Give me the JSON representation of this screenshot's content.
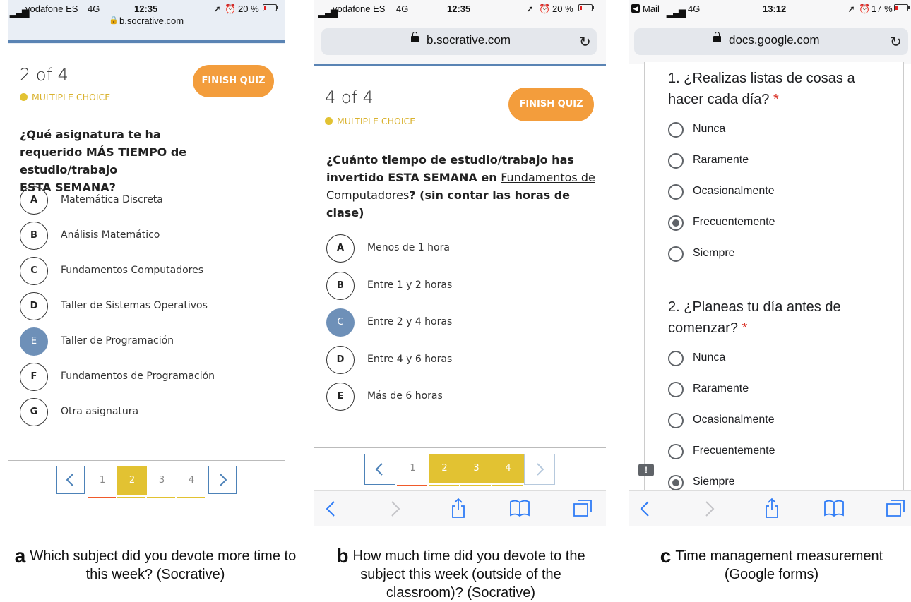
{
  "panel_a": {
    "status": {
      "carrier": "vodafone ES",
      "network": "4G",
      "time": "12:35",
      "battery": "20 %",
      "battery_level": 0.2,
      "url": "b.socrative.com"
    },
    "counter": "2 of 4",
    "question_type": "MULTIPLE CHOICE",
    "finish_label": "FINISH QUIZ",
    "question_lines": [
      "¿Qué asignatura te ha",
      "requerido MÁS TIEMPO de estudio/trabajo",
      "ESTA SEMANA?"
    ],
    "options": [
      {
        "letter": "A",
        "text": "Matemática Discreta",
        "selected": false
      },
      {
        "letter": "B",
        "text": "Análisis Matemático",
        "selected": false
      },
      {
        "letter": "C",
        "text": "Fundamentos Computadores",
        "selected": false
      },
      {
        "letter": "D",
        "text": "Taller de Sistemas Operativos",
        "selected": false
      },
      {
        "letter": "E",
        "text": "Taller de Programación",
        "selected": true
      },
      {
        "letter": "F",
        "text": "Fundamentos de Programación",
        "selected": false
      },
      {
        "letter": "G",
        "text": "Otra asignatura",
        "selected": false
      }
    ],
    "pages": [
      "1",
      "2",
      "3",
      "4"
    ],
    "current_page": "2",
    "caption_letter": "a",
    "caption": "Which subject did you devote more time to this week? (Socrative)"
  },
  "panel_b": {
    "status": {
      "carrier": "vodafone ES",
      "network": "4G",
      "time": "12:35",
      "battery": "20 %",
      "battery_level": 0.2,
      "url": "b.socrative.com"
    },
    "counter": "4 of 4",
    "question_type": "MULTIPLE CHOICE",
    "finish_label": "FINISH QUIZ",
    "question": {
      "line1": "¿Cuánto tiempo de estudio/trabajo has",
      "line2_prefix": "invertido ESTA SEMANA en ",
      "line2_link": "Fundamentos de",
      "line3_link": "Computadores",
      "line3_suffix": "? (sin contar las horas de",
      "line4": "clase)"
    },
    "options": [
      {
        "letter": "A",
        "text": "Menos de 1 hora",
        "selected": false
      },
      {
        "letter": "B",
        "text": "Entre 1 y 2 horas",
        "selected": false
      },
      {
        "letter": "C",
        "text": "Entre 2 y 4 horas",
        "selected": true
      },
      {
        "letter": "D",
        "text": "Entre 4 y 6 horas",
        "selected": false
      },
      {
        "letter": "E",
        "text": "Más de 6 horas",
        "selected": false
      }
    ],
    "pages": [
      "1",
      "2",
      "3",
      "4"
    ],
    "current_page": "4",
    "caption_letter": "b",
    "caption": "How much time did you devote to the subject this week (outside of the classroom)? (Socrative)"
  },
  "panel_c": {
    "status": {
      "back_app": "Mail",
      "network": "4G",
      "time": "13:12",
      "battery": "17 %",
      "battery_level": 0.17,
      "url": "docs.google.com"
    },
    "questions": [
      {
        "line1": "1. ¿Realizas listas de cosas a",
        "line2": "hacer cada día?",
        "required": "*",
        "options": [
          "Nunca",
          "Raramente",
          "Ocasionalmente",
          "Frecuentemente",
          "Siempre"
        ],
        "selected": 3
      },
      {
        "line1": "2. ¿Planeas tu día antes de",
        "line2": "comenzar?",
        "required": "*",
        "options": [
          "Nunca",
          "Raramente",
          "Ocasionalmente",
          "Frecuentemente",
          "Siempre"
        ],
        "selected": 4
      }
    ],
    "caption_letter": "c",
    "caption": "Time management measurement (Google forms)"
  },
  "colors": {
    "finish": "#f39d3c",
    "accent_yellow": "#e2c232",
    "selected_blue": "#6e90b8",
    "nav_blue": "#4d82b8",
    "required_red": "#d93025"
  },
  "icons": [
    "lock-icon",
    "reload-icon",
    "back-arrow-icon",
    "forward-arrow-icon",
    "share-icon",
    "bookmarks-icon",
    "tabs-icon",
    "feedback-icon",
    "location-arrow-icon",
    "alarm-icon"
  ]
}
